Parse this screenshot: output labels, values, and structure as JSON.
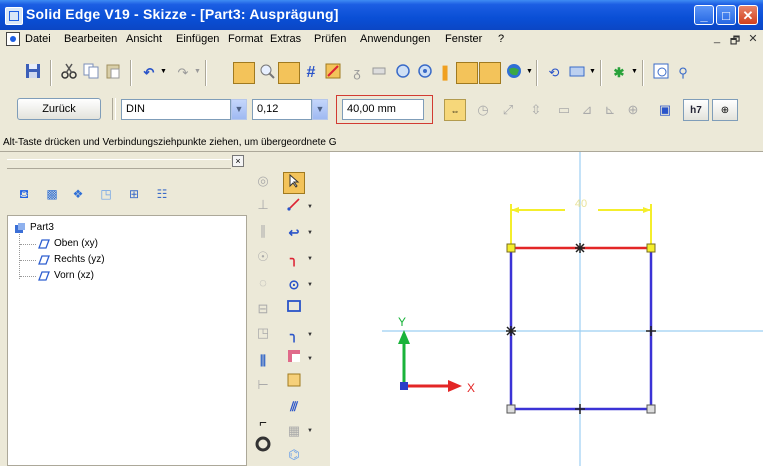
{
  "window": {
    "title": "Solid Edge V19 - Skizze - [Part3: Ausprägung]",
    "buttons": {
      "minimize": "_",
      "maximize": "□",
      "close": "✕"
    }
  },
  "menubar": {
    "items": [
      "Datei",
      "Bearbeiten",
      "Ansicht",
      "Einfügen",
      "Format",
      "Extras",
      "Prüfen",
      "Anwendungen",
      "Fenster",
      "?"
    ],
    "mdi_buttons": [
      "_",
      "🗗",
      "✕"
    ]
  },
  "toolbar": {
    "icons": [
      "save-icon",
      "cut-icon",
      "copy-icon",
      "paste-icon",
      "undo-icon",
      "redo-icon",
      "zoom-area-icon",
      "grid-icon",
      "relationship-icon",
      "measure-icon",
      "view-icon",
      "paint-icon"
    ]
  },
  "ribbon": {
    "back_label": "Zurück",
    "standard": "DIN",
    "precision": "0,12",
    "value": "40,00 mm"
  },
  "status": {
    "prompt": "Alt-Taste drücken und Verbindungsziehpunkte ziehen, um übergeordnete G"
  },
  "pathfinder": {
    "close_label": "×",
    "tree": {
      "root": "Part3",
      "planes": [
        "Oben (xy)",
        "Rechts (yz)",
        "Vorn (xz)"
      ]
    }
  },
  "sketch": {
    "dimension_label": "40",
    "axis_x_label": "X",
    "axis_y_label": "Y",
    "colors": {
      "rectangle": "#3b33d6",
      "top_edge": "#e32626",
      "reference_lines": "#9ccff2",
      "dimension": "#f4ee2c",
      "axis_y": "#19b33a",
      "axis_x": "#e32626"
    }
  }
}
